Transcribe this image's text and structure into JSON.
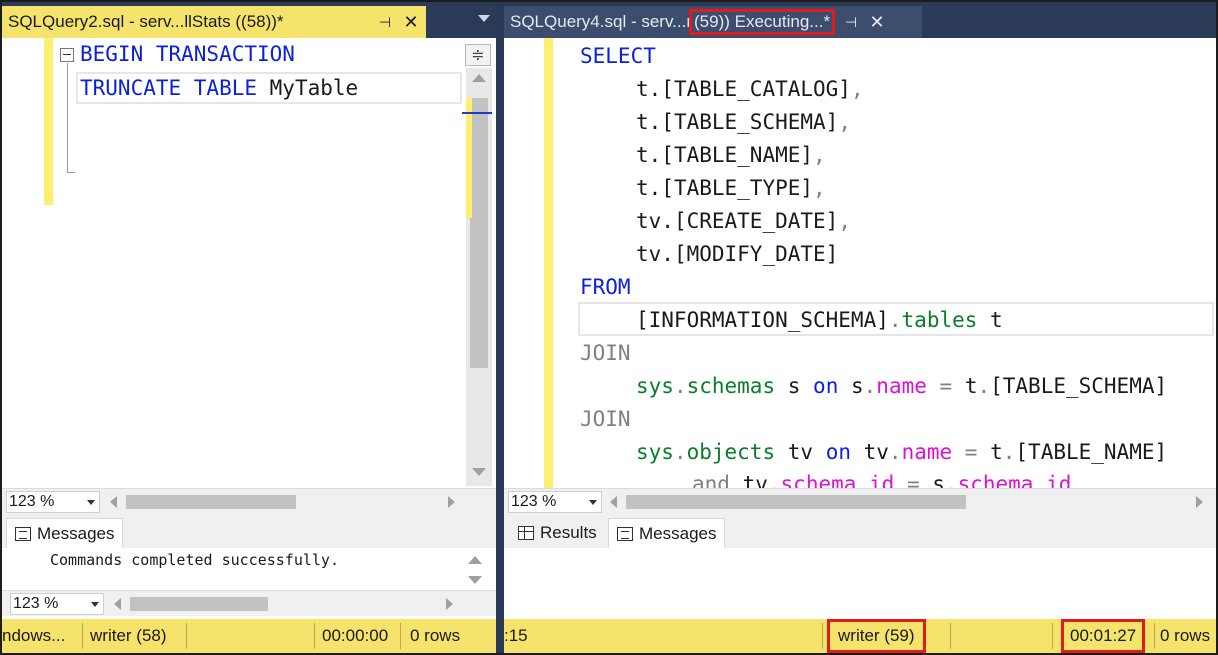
{
  "left": {
    "tab_title": "SQLQuery2.sql - serv...llStats ((58))*",
    "pin_glyph": "⊣",
    "close_glyph": "✕",
    "code": {
      "line1_kw": "BEGIN TRANSACTION",
      "line2_kw": "TRUNCATE TABLE",
      "line2_rest": " MyTable"
    },
    "zoom": "123 %",
    "messages_tab": "Messages",
    "message_text": "Commands completed successfully.",
    "results_zoom": "123 %",
    "status": {
      "connection": "ndows...",
      "user": "writer (58)",
      "elapsed": "00:00:00",
      "rows": "0 rows"
    }
  },
  "right": {
    "tab_title_prefix": "SQLQuery4.sql - serv...r",
    "tab_title_highlight": "(59)) Executing...*",
    "pin_glyph": "⊣",
    "close_glyph": "✕",
    "code": {
      "select": "SELECT",
      "col1_t": "t.",
      "col1": "[TABLE_CATALOG]",
      "col2_t": "t.",
      "col2": "[TABLE_SCHEMA]",
      "col3_t": "t.",
      "col3": "[TABLE_NAME]",
      "col4_t": "t.",
      "col4": "[TABLE_TYPE]",
      "col5_t": "tv.",
      "col5": "[CREATE_DATE]",
      "col6_t": "tv.",
      "col6": "[MODIFY_DATE]",
      "comma": ",",
      "from": "FROM",
      "from_schema": "[INFORMATION_SCHEMA]",
      "from_dot": ".",
      "from_tables": "tables",
      "from_alias": " t",
      "join": "JOIN",
      "j1_sys": "sys",
      "j1_dot": ".",
      "j1_schemas": "schemas",
      "j1_alias": " s ",
      "j1_on": "on",
      "j1_s": " s",
      "j1_dot2": ".",
      "j1_name": "name",
      "j1_eq": " = ",
      "j1_t": "t",
      "j1_dot3": ".",
      "j1_col": "[TABLE_SCHEMA]",
      "join2": "JOIN",
      "j2_sys": "sys",
      "j2_dot": ".",
      "j2_objects": "objects",
      "j2_alias": " tv ",
      "j2_on": "on",
      "j2_tv": " tv",
      "j2_dot2": ".",
      "j2_name": "name",
      "j2_eq": " = ",
      "j2_t": "t",
      "j2_dot3": ".",
      "j2_col": "[TABLE_NAME]",
      "and_kw": "and",
      "and_tv": " tv",
      "and_dot": ".",
      "and_schema_id": "schema_id",
      "and_eq": " = ",
      "and_s": "s",
      "and_dot2": ".",
      "and_sid": "schema_id"
    },
    "zoom": "123 %",
    "results_tab": "Results",
    "messages_tab": "Messages",
    "status": {
      "partial": ":15",
      "user": "writer (59)",
      "elapsed": "00:01:27",
      "rows": "0 rows"
    }
  },
  "colors": {
    "keyword": "#0a1fe0",
    "system_object": "#0a7d2a",
    "function": "#e00fd6",
    "operator": "#808080",
    "highlight_box": "#e21b1b",
    "status_bar": "#f5e36b"
  }
}
